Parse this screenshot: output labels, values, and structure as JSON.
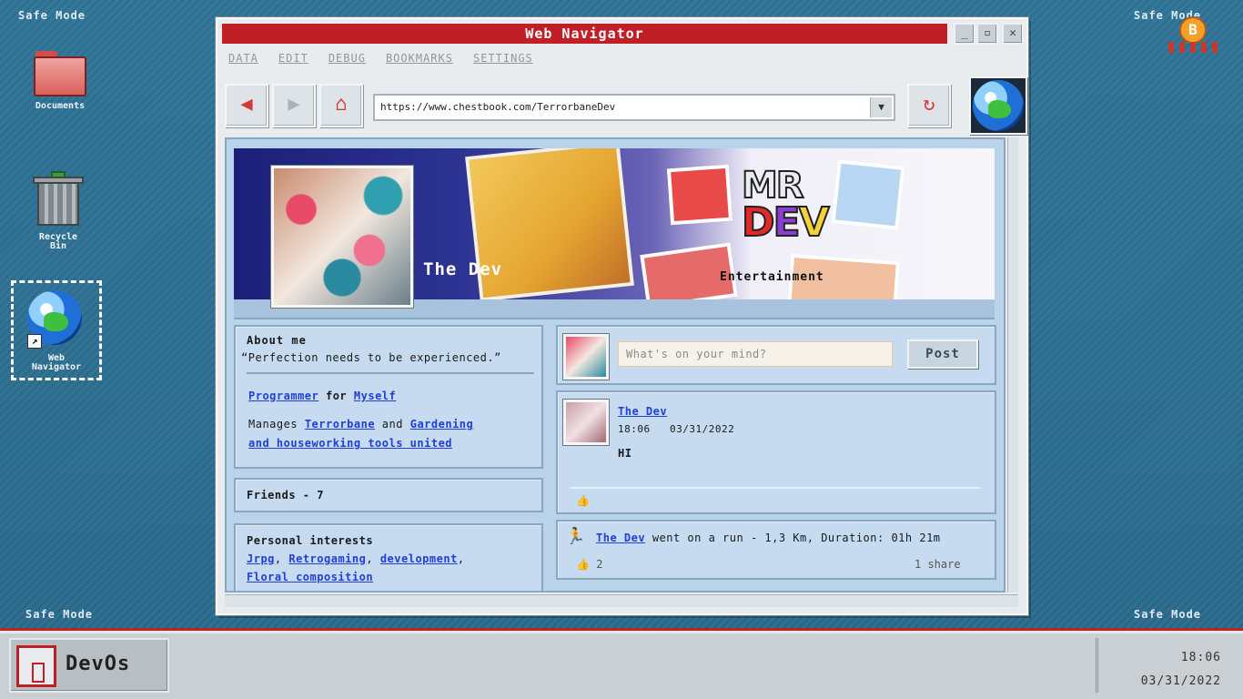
{
  "desktop": {
    "safe_mode_labels": [
      "Safe Mode",
      "Safe Mode",
      "Safe Mode",
      "Safe Mode"
    ],
    "icons": [
      {
        "label": "Documents"
      },
      {
        "label": "Recycle Bin"
      },
      {
        "label": "Web Navigator"
      }
    ]
  },
  "window": {
    "title": "Web Navigator",
    "minimize": "_",
    "maximize": "▫",
    "close": "✕",
    "menu": [
      "DATA",
      "EDIT",
      "DEBUG",
      "BOOKMARKS",
      "SETTINGS"
    ],
    "url": "https://www.chestbook.com/TerrorbaneDev",
    "url_dropdown": "▼"
  },
  "profile": {
    "name": "The Dev",
    "cover_logo_top": "MR",
    "cover_logo_d": "D",
    "cover_logo_e": "E",
    "cover_logo_v": "V",
    "cover_caption": "Entertainment",
    "about": {
      "title": "About me",
      "quote": "“Perfection needs to be experienced.”",
      "programmer": "Programmer",
      "for": "for",
      "myself": "Myself",
      "manages": "Manages",
      "terrorbane": "Terrorbane",
      "and": "and",
      "gardening_1": "Gardening",
      "gardening_2": "and houseworking tools united"
    },
    "friends": "Friends - 7",
    "interests": {
      "title": "Personal interests",
      "item1": "Jrpg",
      "item2": "Retrogaming",
      "item3": "development",
      "item4": "Floral composition",
      "sep": ","
    }
  },
  "composer": {
    "placeholder": "What's on your mind?",
    "post_label": "Post"
  },
  "feed": {
    "post1": {
      "author": "The Dev",
      "time": "18:06",
      "date": "03/31/2022",
      "body": "HI"
    },
    "activity": {
      "author": "The Dev",
      "text": "went on a run - 1,3 Km, Duration: 01h 21m",
      "likes": "2",
      "shares": "1 share"
    }
  },
  "taskbar": {
    "start_label": "DevOs",
    "time": "18:06",
    "date": "03/31/2022"
  }
}
